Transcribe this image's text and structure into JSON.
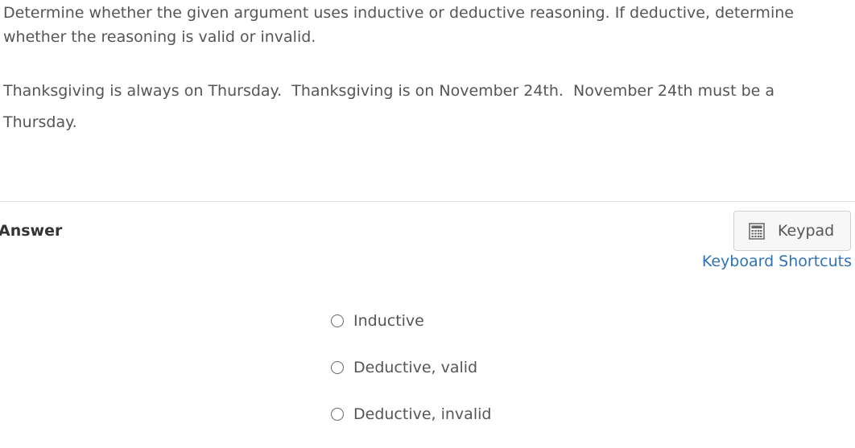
{
  "question": {
    "prompt": "Determine whether the given argument uses inductive or deductive reasoning. If deductive, determine whether the reasoning is valid or invalid.",
    "argument_line1": "Thanksgiving is always on Thursday.  Thanksgiving is on November 24th.  November 24th must be a",
    "argument_line2": "Thursday."
  },
  "answer": {
    "label": "Answer",
    "keypad_label": "Keypad",
    "keypad_icon": "calculator-icon",
    "shortcuts_label": "Keyboard Shortcuts",
    "options": [
      {
        "label": "Inductive"
      },
      {
        "label": "Deductive, valid"
      },
      {
        "label": "Deductive, invalid"
      }
    ]
  },
  "colors": {
    "text": "#555555",
    "link": "#2f72b8",
    "divider": "#e3e3e3"
  }
}
